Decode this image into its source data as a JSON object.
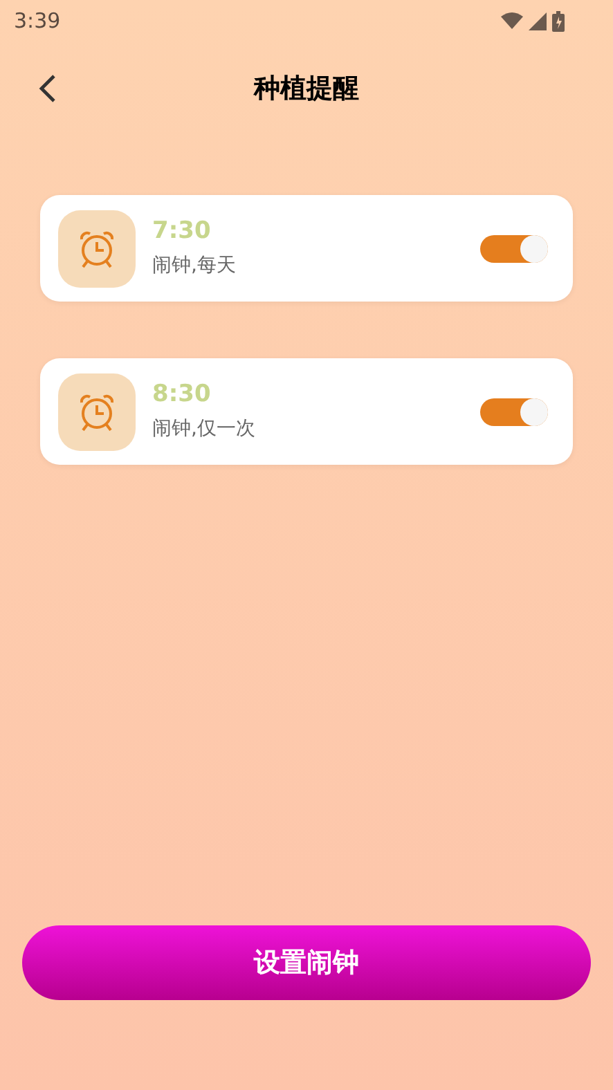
{
  "status_bar": {
    "time": "3:39"
  },
  "header": {
    "title": "种植提醒"
  },
  "alarms": [
    {
      "time": "7:30",
      "label": "闹钟,每天",
      "on": true
    },
    {
      "time": "8:30",
      "label": "闹钟,仅一次",
      "on": true
    }
  ],
  "button": {
    "label": "设置闹钟"
  }
}
